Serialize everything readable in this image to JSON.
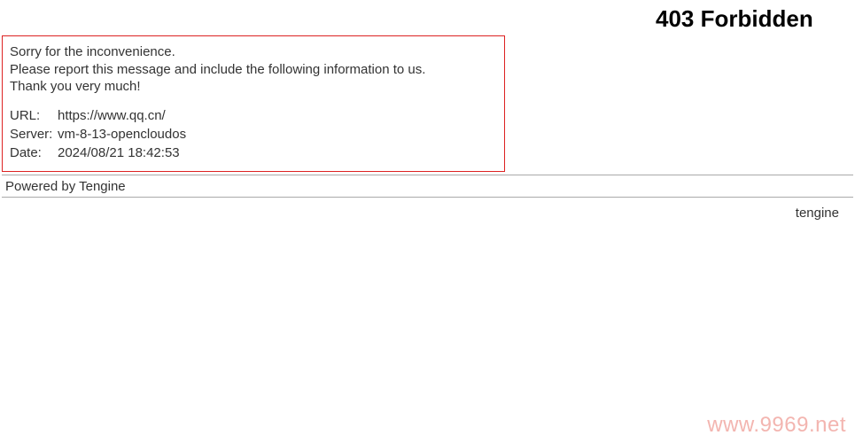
{
  "heading": "403 Forbidden",
  "apology": {
    "line1": "Sorry for the inconvenience.",
    "line2": "Please report this message and include the following information to us.",
    "line3": "Thank you very much!"
  },
  "info": {
    "url_label": "URL:",
    "url_value": "https://www.qq.cn/",
    "server_label": "Server:",
    "server_value": "vm-8-13-opencloudos",
    "date_label": "Date:",
    "date_value": "2024/08/21 18:42:53"
  },
  "powered": "Powered by Tengine",
  "footer_right": "tengine",
  "watermark": "www.9969.net"
}
